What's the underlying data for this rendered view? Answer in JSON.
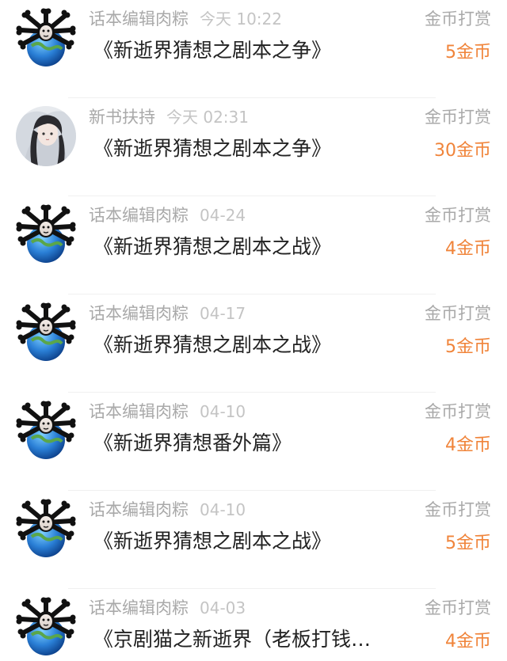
{
  "colors": {
    "accent_coin": "#f0843a",
    "secondary_text": "#a9a9a9",
    "time_text": "#c4c4c4",
    "title_text": "#222222"
  },
  "rows": [
    {
      "avatar_icon": "bone-skull-earth-icon",
      "sender": "话本编辑肉粽",
      "time": "今天 10:22",
      "title": "《新逝界猜想之剧本之争》",
      "type": "金币打赏",
      "amount": "5金币"
    },
    {
      "avatar_icon": "anime-character-avatar",
      "sender": "新书扶持",
      "time": "今天 02:31",
      "title": "《新逝界猜想之剧本之争》",
      "type": "金币打赏",
      "amount": "30金币"
    },
    {
      "avatar_icon": "bone-skull-earth-icon",
      "sender": "话本编辑肉粽",
      "time": "04-24",
      "title": "《新逝界猜想之剧本之战》",
      "type": "金币打赏",
      "amount": "4金币"
    },
    {
      "avatar_icon": "bone-skull-earth-icon",
      "sender": "话本编辑肉粽",
      "time": "04-17",
      "title": "《新逝界猜想之剧本之战》",
      "type": "金币打赏",
      "amount": "5金币"
    },
    {
      "avatar_icon": "bone-skull-earth-icon",
      "sender": "话本编辑肉粽",
      "time": "04-10",
      "title": "《新逝界猜想番外篇》",
      "type": "金币打赏",
      "amount": "4金币"
    },
    {
      "avatar_icon": "bone-skull-earth-icon",
      "sender": "话本编辑肉粽",
      "time": "04-10",
      "title": "《新逝界猜想之剧本之战》",
      "type": "金币打赏",
      "amount": "5金币"
    },
    {
      "avatar_icon": "bone-skull-earth-icon",
      "sender": "话本编辑肉粽",
      "time": "04-03",
      "title": "《京剧猫之新逝界（老板打钱…",
      "type": "金币打赏",
      "amount": "4金币"
    }
  ]
}
